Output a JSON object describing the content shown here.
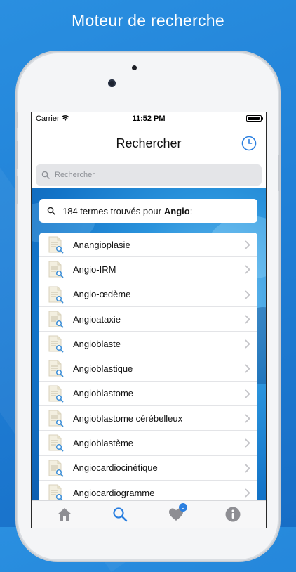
{
  "promo": {
    "title": "Moteur de recherche"
  },
  "status_bar": {
    "carrier": "Carrier",
    "time": "11:52 PM",
    "battery_level": 0.95
  },
  "nav": {
    "title": "Rechercher",
    "history_icon": "clock-icon"
  },
  "search": {
    "placeholder": "Rechercher",
    "value": ""
  },
  "results": {
    "summary": "184 termes trouvés pour",
    "query": "Angio",
    "suffix": ":",
    "items": [
      "Anangioplasie",
      "Angio-IRM",
      "Angio-œdème",
      "Angioataxie",
      "Angioblaste",
      "Angioblastique",
      "Angioblastome",
      "Angioblastome cérébelleux",
      "Angioblastème",
      "Angiocardiocinétique",
      "Angiocardiogramme"
    ]
  },
  "tabs": [
    {
      "name": "home",
      "icon": "home-icon",
      "active": false
    },
    {
      "name": "search",
      "icon": "search-icon",
      "active": true
    },
    {
      "name": "favorites",
      "icon": "heart-icon",
      "active": false,
      "badge": "0"
    },
    {
      "name": "info",
      "icon": "info-icon",
      "active": false
    }
  ],
  "colors": {
    "accent": "#2a7fe0",
    "tab_inactive": "#8e8e93",
    "background": "#1f7fd6"
  }
}
